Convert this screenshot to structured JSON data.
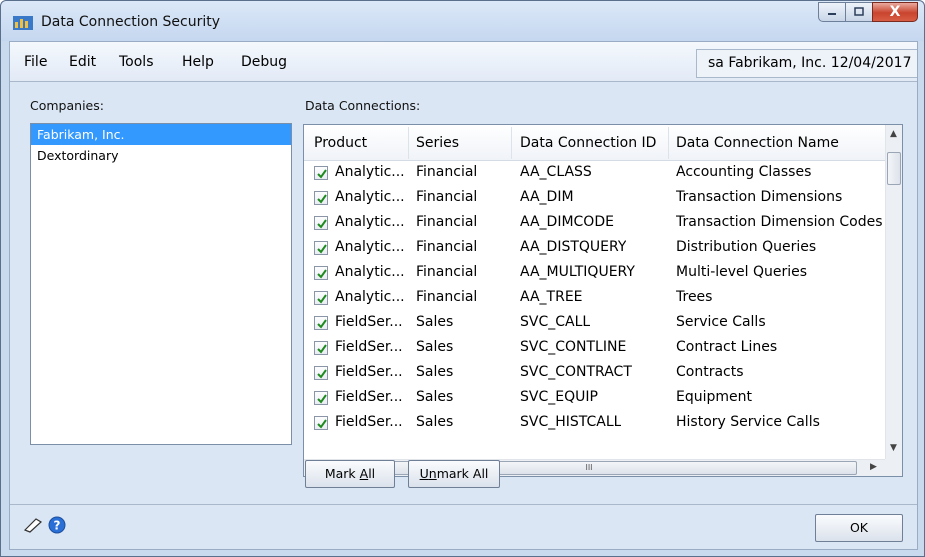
{
  "window": {
    "title": "Data Connection Security",
    "minimize_label": "",
    "maximize_label": "",
    "close_label": "X"
  },
  "menu": {
    "items": [
      "File",
      "Edit",
      "Tools",
      "Help",
      "Debug"
    ],
    "user_info": "sa  Fabrikam, Inc.  12/04/2017"
  },
  "companies": {
    "label": "Companies:",
    "items": [
      "Fabrikam, Inc.",
      "Dextordinary"
    ],
    "selected_index": 0
  },
  "connections": {
    "label": "Data Connections:",
    "columns": [
      "Product",
      "Series",
      "Data Connection ID",
      "Data Connection Name"
    ],
    "rows": [
      {
        "checked": true,
        "product": "Analytic...",
        "series": "Financial",
        "id": "AA_CLASS",
        "name": "Accounting Classes"
      },
      {
        "checked": true,
        "product": "Analytic...",
        "series": "Financial",
        "id": "AA_DIM",
        "name": "Transaction Dimensions"
      },
      {
        "checked": true,
        "product": "Analytic...",
        "series": "Financial",
        "id": "AA_DIMCODE",
        "name": "Transaction Dimension Codes"
      },
      {
        "checked": true,
        "product": "Analytic...",
        "series": "Financial",
        "id": "AA_DISTQUERY",
        "name": "Distribution Queries"
      },
      {
        "checked": true,
        "product": "Analytic...",
        "series": "Financial",
        "id": "AA_MULTIQUERY",
        "name": "Multi-level Queries"
      },
      {
        "checked": true,
        "product": "Analytic...",
        "series": "Financial",
        "id": "AA_TREE",
        "name": "Trees"
      },
      {
        "checked": true,
        "product": "FieldSer...",
        "series": "Sales",
        "id": "SVC_CALL",
        "name": "Service Calls"
      },
      {
        "checked": true,
        "product": "FieldSer...",
        "series": "Sales",
        "id": "SVC_CONTLINE",
        "name": "Contract Lines"
      },
      {
        "checked": true,
        "product": "FieldSer...",
        "series": "Sales",
        "id": "SVC_CONTRACT",
        "name": "Contracts"
      },
      {
        "checked": true,
        "product": "FieldSer...",
        "series": "Sales",
        "id": "SVC_EQUIP",
        "name": "Equipment"
      },
      {
        "checked": true,
        "product": "FieldSer...",
        "series": "Sales",
        "id": "SVC_HISTCALL",
        "name": "History Service Calls"
      }
    ],
    "hscroll_grip": "III"
  },
  "buttons": {
    "mark_all_pre": "Mark ",
    "mark_all_acc": "A",
    "mark_all_post": "ll",
    "unmark_all_pre": "U",
    "unmark_all_acc": "n",
    "unmark_all_post": "mark All",
    "ok": "OK"
  },
  "colors": {
    "selection": "#3399ff",
    "check": "#1f8a1f",
    "help_icon": "#2a6fd6"
  }
}
